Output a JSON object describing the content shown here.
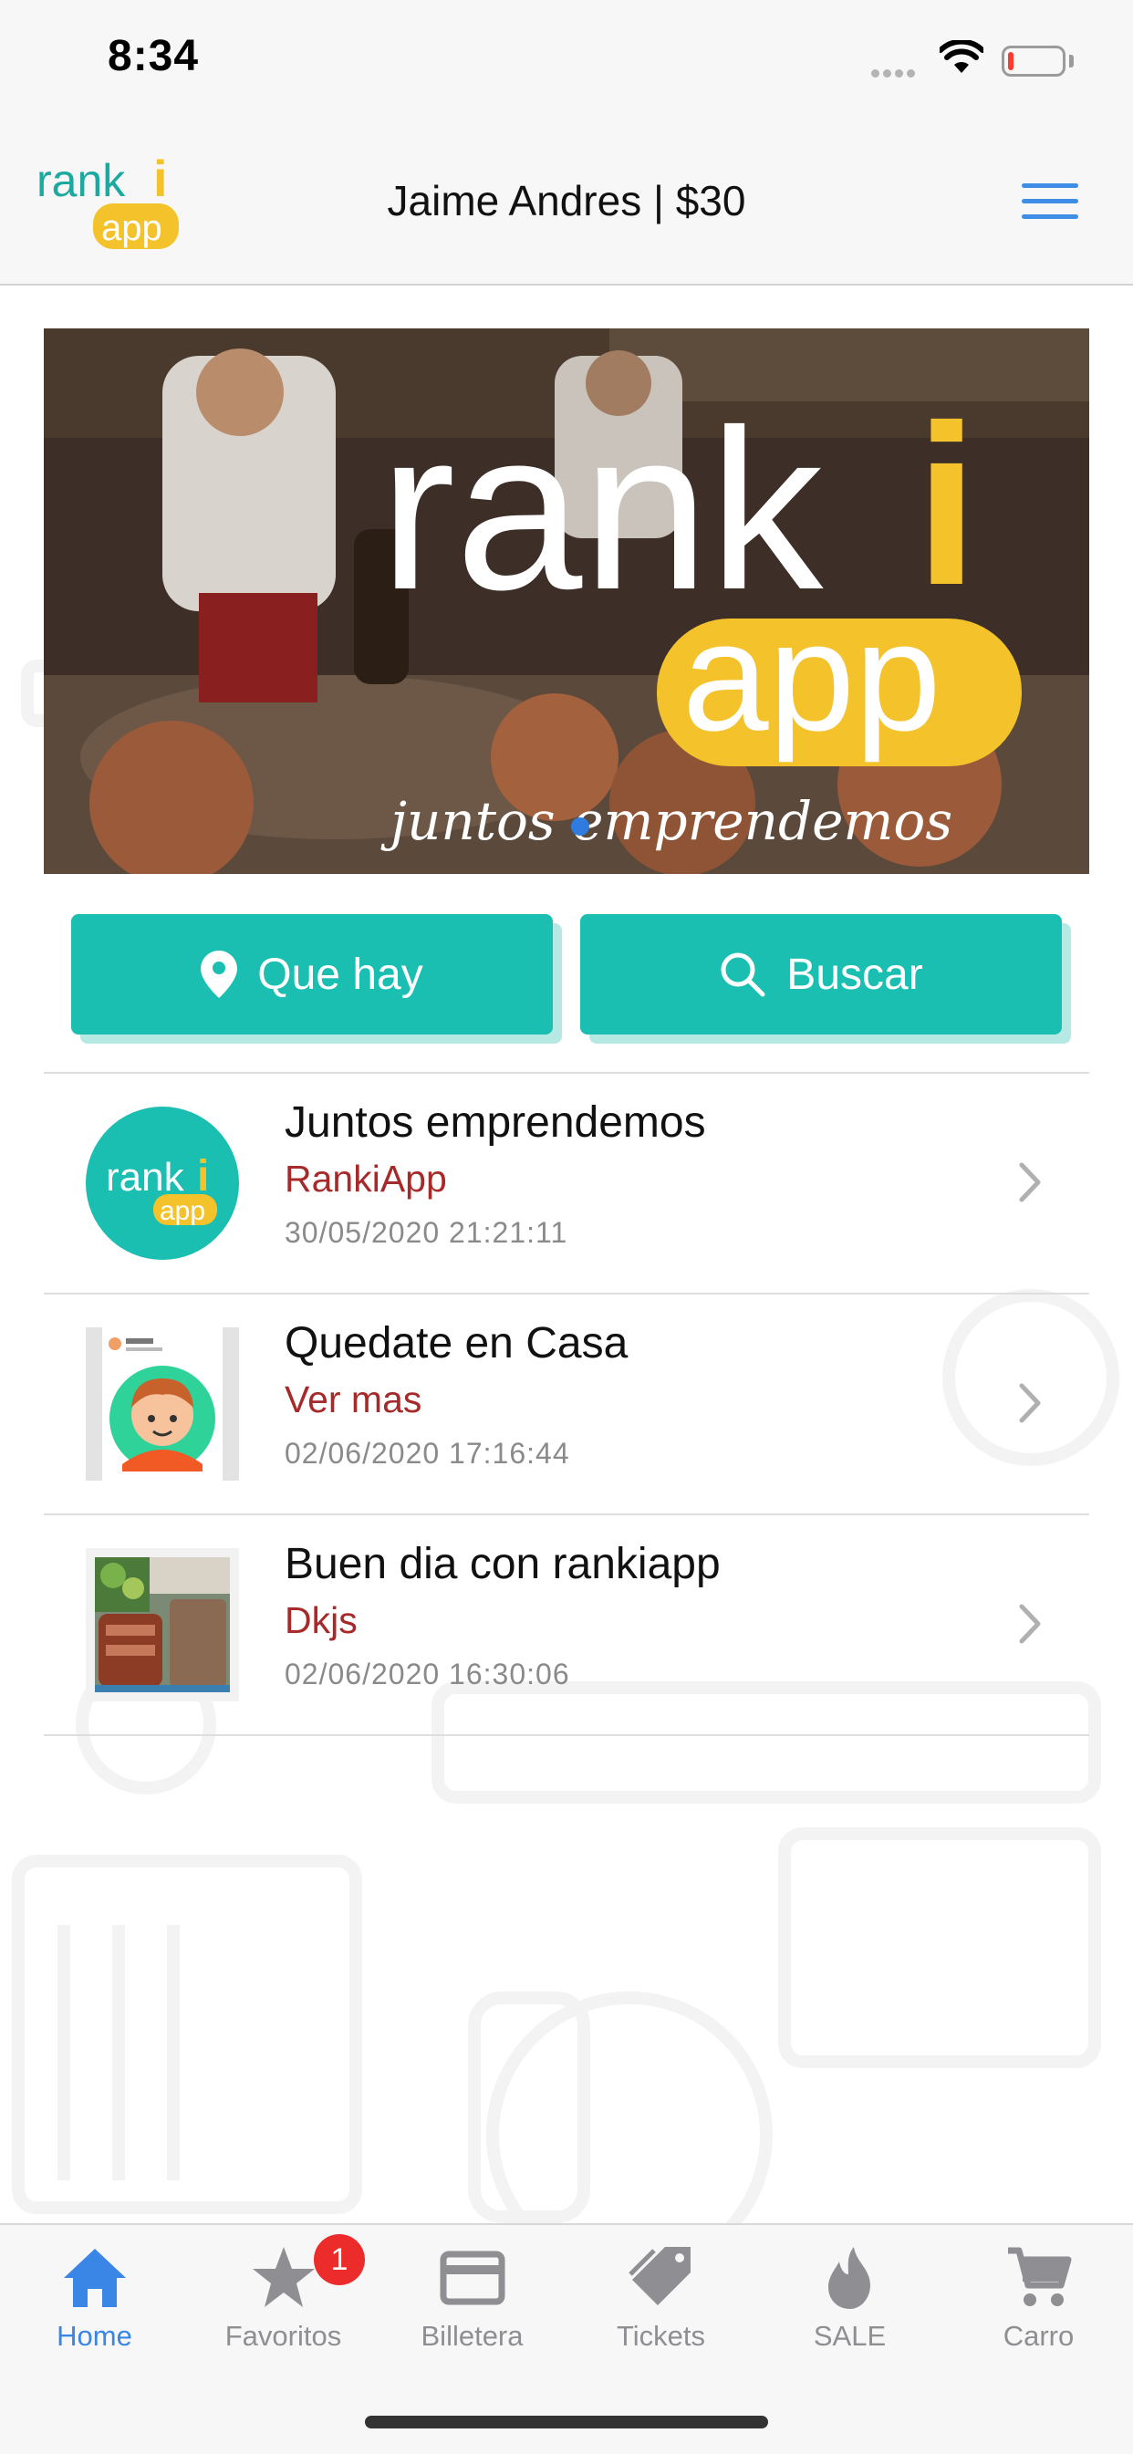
{
  "status_bar": {
    "time": "8:34"
  },
  "header": {
    "logo_text_top": "rank",
    "logo_text_i": "i",
    "logo_text_bottom": "app",
    "title": "Jaime Andres | $30"
  },
  "banner": {
    "brand_top": "rank",
    "brand_i": "i",
    "brand_bottom": "app",
    "tagline": "juntos emprendemos"
  },
  "actions": {
    "quehay_label": "Que hay",
    "buscar_label": "Buscar"
  },
  "news": [
    {
      "title": "Juntos emprendemos",
      "subtitle": "RankiApp",
      "date": "30/05/2020 21:21:11"
    },
    {
      "title": "Quedate en Casa",
      "subtitle": "Ver mas",
      "date": "02/06/2020 17:16:44"
    },
    {
      "title": "Buen dia con rankiapp",
      "subtitle": "Dkjs",
      "date": "02/06/2020 16:30:06"
    }
  ],
  "tabbar": {
    "items": [
      {
        "label": "Home",
        "icon": "home-icon",
        "active": true
      },
      {
        "label": "Favoritos",
        "icon": "star-icon"
      },
      {
        "label": "Billetera",
        "icon": "credit-card-icon"
      },
      {
        "label": "Tickets",
        "icon": "tag-icon"
      },
      {
        "label": "SALE",
        "icon": "flame-icon"
      },
      {
        "label": "Carro",
        "icon": "cart-icon"
      }
    ],
    "favoritos_badge": "1"
  },
  "colors": {
    "accent": "#1abfb2",
    "subtitle": "#a62a2a",
    "active_tab": "#3a86e6",
    "brand_yellow": "#f4c22b"
  }
}
